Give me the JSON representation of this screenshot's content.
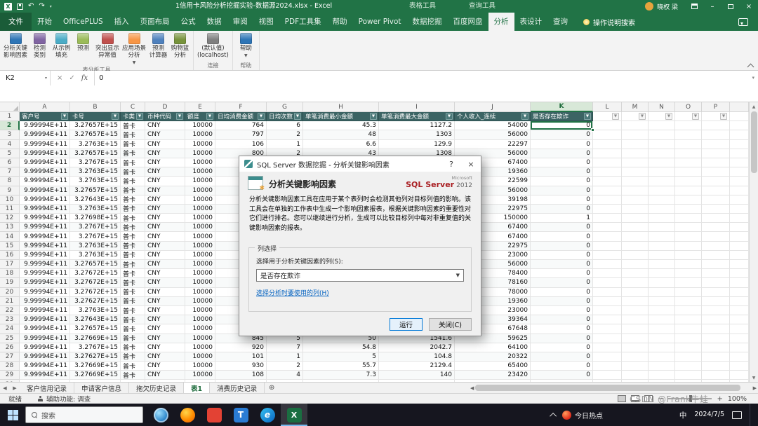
{
  "titlebar": {
    "title": "1信用卡风险分析挖掘实验-数据源2024.xlsx - Excel",
    "contextual_tools": [
      "表格工具",
      "查询工具"
    ],
    "user_name": "晓权 梁"
  },
  "ribbon": {
    "tabs": [
      "文件",
      "开始",
      "OfficePLUS",
      "插入",
      "页面布局",
      "公式",
      "数据",
      "审阅",
      "视图",
      "PDF工具集",
      "帮助",
      "Power Pivot",
      "数据挖掘",
      "百度网盘",
      "分析",
      "表设计",
      "查询"
    ],
    "active_tab": "分析",
    "search_label": "操作说明搜索",
    "groups": [
      {
        "label": "表分析工具",
        "buttons": [
          {
            "label": "分析关键\n影响因素",
            "icon": "key-influencers-icon",
            "color": "#2e75b6"
          },
          {
            "label": "检测\n类别",
            "icon": "detect-categories-icon",
            "color": "#8064a2"
          },
          {
            "label": "从示例\n填充",
            "icon": "fill-from-example-icon",
            "color": "#4bacc6"
          },
          {
            "label": "预测",
            "icon": "forecast-icon",
            "color": "#9bbb59"
          },
          {
            "label": "突出显示\n异常值",
            "icon": "highlight-exceptions-icon",
            "color": "#c0504d"
          },
          {
            "label": "应用场景\n分析",
            "icon": "scenario-analysis-icon",
            "color": "#f79646",
            "dropdown": true
          },
          {
            "label": "预测\n计算器",
            "icon": "prediction-calculator-icon",
            "color": "#4f81bd"
          },
          {
            "label": "购物篮\n分析",
            "icon": "shopping-basket-icon",
            "color": "#77933c"
          }
        ]
      },
      {
        "label": "连接",
        "buttons": [
          {
            "label": "(默认值)\n(localhost)",
            "icon": "server-connection-icon",
            "color": "#7f7f7f"
          }
        ]
      },
      {
        "label": "帮助",
        "buttons": [
          {
            "label": "帮助",
            "icon": "help-icon",
            "color": "#2e75b6",
            "dropdown": true
          }
        ]
      }
    ]
  },
  "formula_bar": {
    "name_box": "K2",
    "value": "0"
  },
  "grid": {
    "selected_cell": "K2",
    "column_letters": [
      "A",
      "B",
      "C",
      "D",
      "E",
      "F",
      "G",
      "H",
      "I",
      "J",
      "K",
      "L",
      "M",
      "N",
      "O",
      "P"
    ],
    "headers": [
      "客户号",
      "卡号",
      "卡类别",
      "币种代码",
      "额度",
      "日均消费金额",
      "日均次数",
      "单笔消费最小金额",
      "单笔消费最大金额",
      "个人收入_连续",
      "是否存在欺诈"
    ],
    "rows": [
      [
        "9.99994E+11",
        "3.27657E+15",
        "普卡",
        "CNY",
        "10000",
        "764",
        "6",
        "45.3",
        "1127.2",
        "54000",
        "0"
      ],
      [
        "9.99994E+11",
        "3.27657E+15",
        "普卡",
        "CNY",
        "10000",
        "797",
        "2",
        "48",
        "1303",
        "56000",
        "0"
      ],
      [
        "9.99994E+11",
        "3.2763E+15",
        "普卡",
        "CNY",
        "10000",
        "106",
        "1",
        "6.6",
        "129.9",
        "22297",
        "0"
      ],
      [
        "9.99994E+11",
        "3.27657E+15",
        "普卡",
        "CNY",
        "10000",
        "800",
        "2",
        "43",
        "1308",
        "56000",
        "0"
      ],
      [
        "9.99994E+11",
        "3.2767E+15",
        "普卡",
        "CNY",
        "10000",
        "",
        "",
        "",
        "",
        "67400",
        "0"
      ],
      [
        "9.99994E+11",
        "3.2763E+15",
        "普卡",
        "CNY",
        "10000",
        "",
        "",
        "",
        "",
        "19360",
        "0"
      ],
      [
        "9.99994E+11",
        "3.2763E+15",
        "普卡",
        "CNY",
        "10000",
        "",
        "",
        "",
        "",
        "22599",
        "0"
      ],
      [
        "9.99994E+11",
        "3.27657E+15",
        "普卡",
        "CNY",
        "10000",
        "",
        "",
        "",
        "",
        "56000",
        "0"
      ],
      [
        "9.99994E+11",
        "3.27643E+15",
        "普卡",
        "CNY",
        "10000",
        "",
        "",
        "",
        "",
        "39198",
        "0"
      ],
      [
        "9.99994E+11",
        "3.2763E+15",
        "普卡",
        "CNY",
        "10000",
        "",
        "",
        "",
        "",
        "22975",
        "0"
      ],
      [
        "9.99994E+11",
        "3.27698E+15",
        "普卡",
        "CNY",
        "10000",
        "",
        "",
        "",
        "",
        "150000",
        "1"
      ],
      [
        "9.99994E+11",
        "3.2767E+15",
        "普卡",
        "CNY",
        "10000",
        "",
        "",
        "",
        "",
        "67400",
        "0"
      ],
      [
        "9.99994E+11",
        "3.2767E+15",
        "普卡",
        "CNY",
        "10000",
        "",
        "",
        "",
        "",
        "67400",
        "0"
      ],
      [
        "9.99994E+11",
        "3.2763E+15",
        "普卡",
        "CNY",
        "10000",
        "",
        "",
        "",
        "",
        "22975",
        "0"
      ],
      [
        "9.99994E+11",
        "3.2763E+15",
        "普卡",
        "CNY",
        "10000",
        "",
        "",
        "",
        "",
        "23000",
        "0"
      ],
      [
        "9.99994E+11",
        "3.27657E+15",
        "普卡",
        "CNY",
        "10000",
        "",
        "",
        "",
        "",
        "56000",
        "0"
      ],
      [
        "9.99994E+11",
        "3.27672E+15",
        "普卡",
        "CNY",
        "10000",
        "",
        "",
        "",
        "",
        "78400",
        "0"
      ],
      [
        "9.99994E+11",
        "3.27672E+15",
        "普卡",
        "CNY",
        "10000",
        "",
        "",
        "",
        "",
        "78160",
        "0"
      ],
      [
        "9.99994E+11",
        "3.27672E+15",
        "普卡",
        "CNY",
        "10000",
        "",
        "",
        "",
        "",
        "78000",
        "0"
      ],
      [
        "9.99994E+11",
        "3.27627E+15",
        "普卡",
        "CNY",
        "10000",
        "",
        "",
        "",
        "",
        "19360",
        "0"
      ],
      [
        "9.99994E+11",
        "3.2763E+15",
        "普卡",
        "CNY",
        "10000",
        "",
        "",
        "",
        "",
        "23000",
        "0"
      ],
      [
        "9.99994E+11",
        "3.27643E+15",
        "普卡",
        "CNY",
        "10000",
        "",
        "",
        "",
        "",
        "39364",
        "0"
      ],
      [
        "9.99994E+11",
        "3.27657E+15",
        "普卡",
        "CNY",
        "10000",
        "",
        "",
        "",
        "",
        "67648",
        "0"
      ],
      [
        "9.99994E+11",
        "3.27669E+15",
        "普卡",
        "CNY",
        "10000",
        "845",
        "5",
        "50",
        "1541.6",
        "59625",
        "0"
      ],
      [
        "9.99994E+11",
        "3.2767E+15",
        "普卡",
        "CNY",
        "10000",
        "920",
        "7",
        "54.8",
        "2042.7",
        "64100",
        "0"
      ],
      [
        "9.99994E+11",
        "3.27627E+15",
        "普卡",
        "CNY",
        "10000",
        "101",
        "1",
        "5",
        "104.8",
        "20322",
        "0"
      ],
      [
        "9.99994E+11",
        "3.27669E+15",
        "普卡",
        "CNY",
        "10000",
        "930",
        "2",
        "55.7",
        "2129.4",
        "65400",
        "0"
      ],
      [
        "9.99994E+11",
        "3.27669E+15",
        "普卡",
        "CNY",
        "10000",
        "108",
        "4",
        "7.3",
        "140",
        "23420",
        "0"
      ]
    ]
  },
  "dialog": {
    "title": "SQL Server 数据挖掘 - 分析关键影响因素",
    "help_button": "?",
    "close_x": "×",
    "heading": "分析关键影响因素",
    "logo_brand": "Microsoft",
    "logo_product": "SQL Server",
    "logo_year": "2012",
    "description": "分析关键影响因素工具在应用于某个表列时会检测其他列对目标列值的影响。该工具会在单独的工作表中生成一个影响因素报表，根据关键影响因素的重要性对它们进行排名。您可以继续进行分析，生成可以比较目标列中每对非重复值的关键影响因素的报表。",
    "group_label": "列选择",
    "column_select_label": "选择用于分析关键因素的列(S):",
    "column_select_value": "是否存在欺诈",
    "link": "选择分析时要使用的列(H)",
    "run_button": "运行",
    "close_button": "关闭(C)"
  },
  "sheet_tabs": {
    "tabs": [
      "客户信用记录",
      "申请客户信息",
      "拖欠历史记录",
      "表1",
      "消费历史记录"
    ],
    "active": "表1"
  },
  "status_bar": {
    "ready": "就绪",
    "accessibility": "辅助功能: 调查",
    "zoom": "100%"
  },
  "taskbar": {
    "search_placeholder": "搜索",
    "hot_news": "今日热点",
    "ime": "中",
    "date": "2024/7/5"
  },
  "watermark": "CSDN @Frank牛蛙"
}
